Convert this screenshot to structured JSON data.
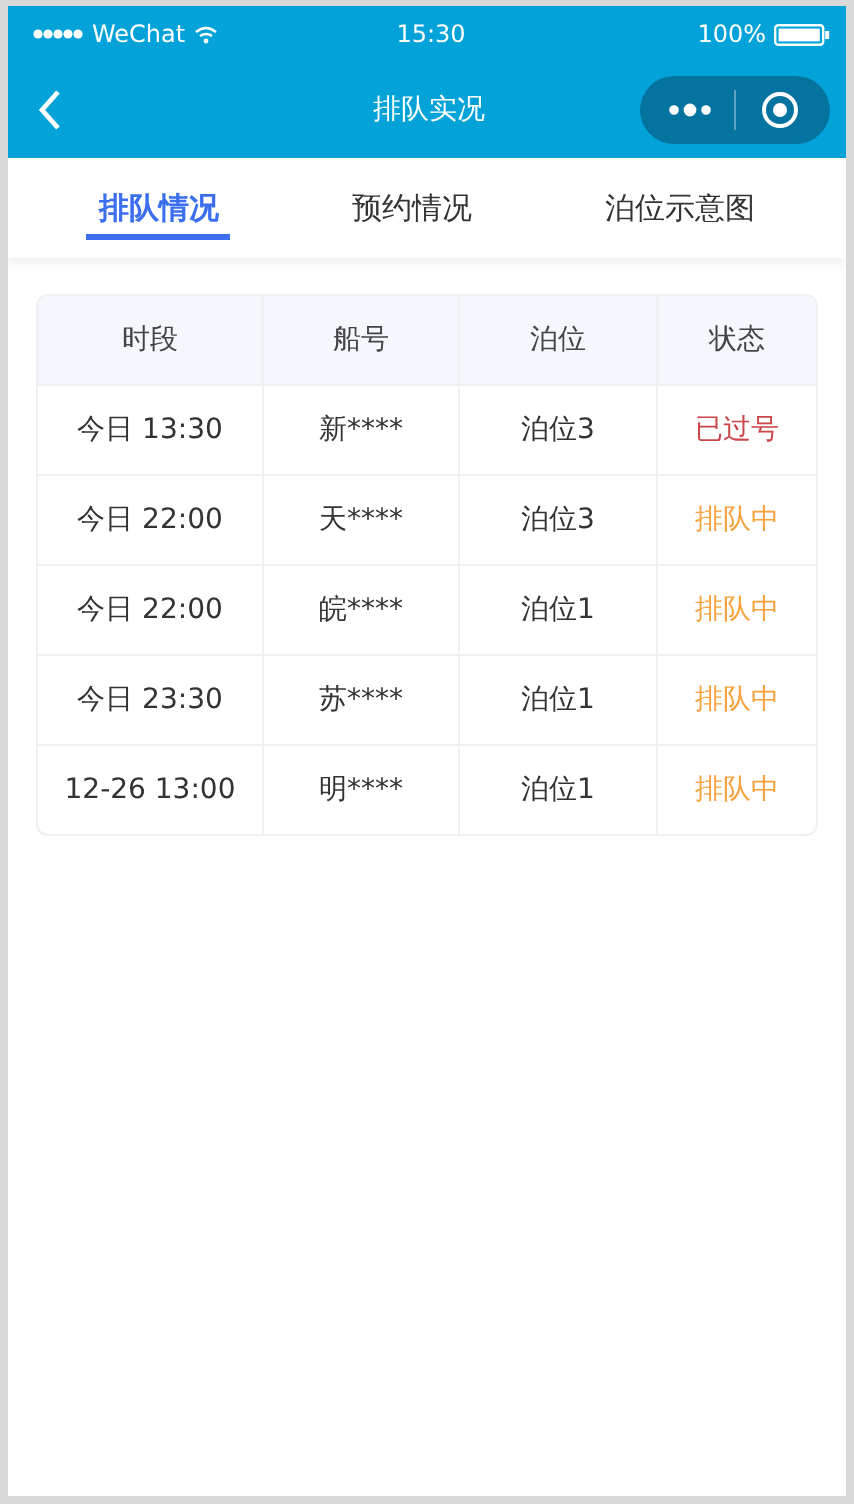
{
  "status_bar": {
    "carrier": "WeChat",
    "time": "15:30",
    "battery": "100%"
  },
  "nav": {
    "title": "排队实况"
  },
  "tabs": [
    {
      "label": "排队情况",
      "selected": true
    },
    {
      "label": "预约情况",
      "selected": false
    },
    {
      "label": "泊位示意图",
      "selected": false
    }
  ],
  "table": {
    "columns": [
      "时段",
      "船号",
      "泊位",
      "状态"
    ],
    "rows": [
      {
        "time": "今日 13:30",
        "ship": "新****",
        "berth": "泊位3",
        "status": "已过号",
        "kind": "passed"
      },
      {
        "time": "今日 22:00",
        "ship": "天****",
        "berth": "泊位3",
        "status": "排队中",
        "kind": "queued"
      },
      {
        "time": "今日 22:00",
        "ship": "皖****",
        "berth": "泊位1",
        "status": "排队中",
        "kind": "queued"
      },
      {
        "time": "今日 23:30",
        "ship": "苏****",
        "berth": "泊位1",
        "status": "排队中",
        "kind": "queued"
      },
      {
        "time": "12-26 13:00",
        "ship": "明****",
        "berth": "泊位1",
        "status": "排队中",
        "kind": "queued"
      }
    ]
  }
}
